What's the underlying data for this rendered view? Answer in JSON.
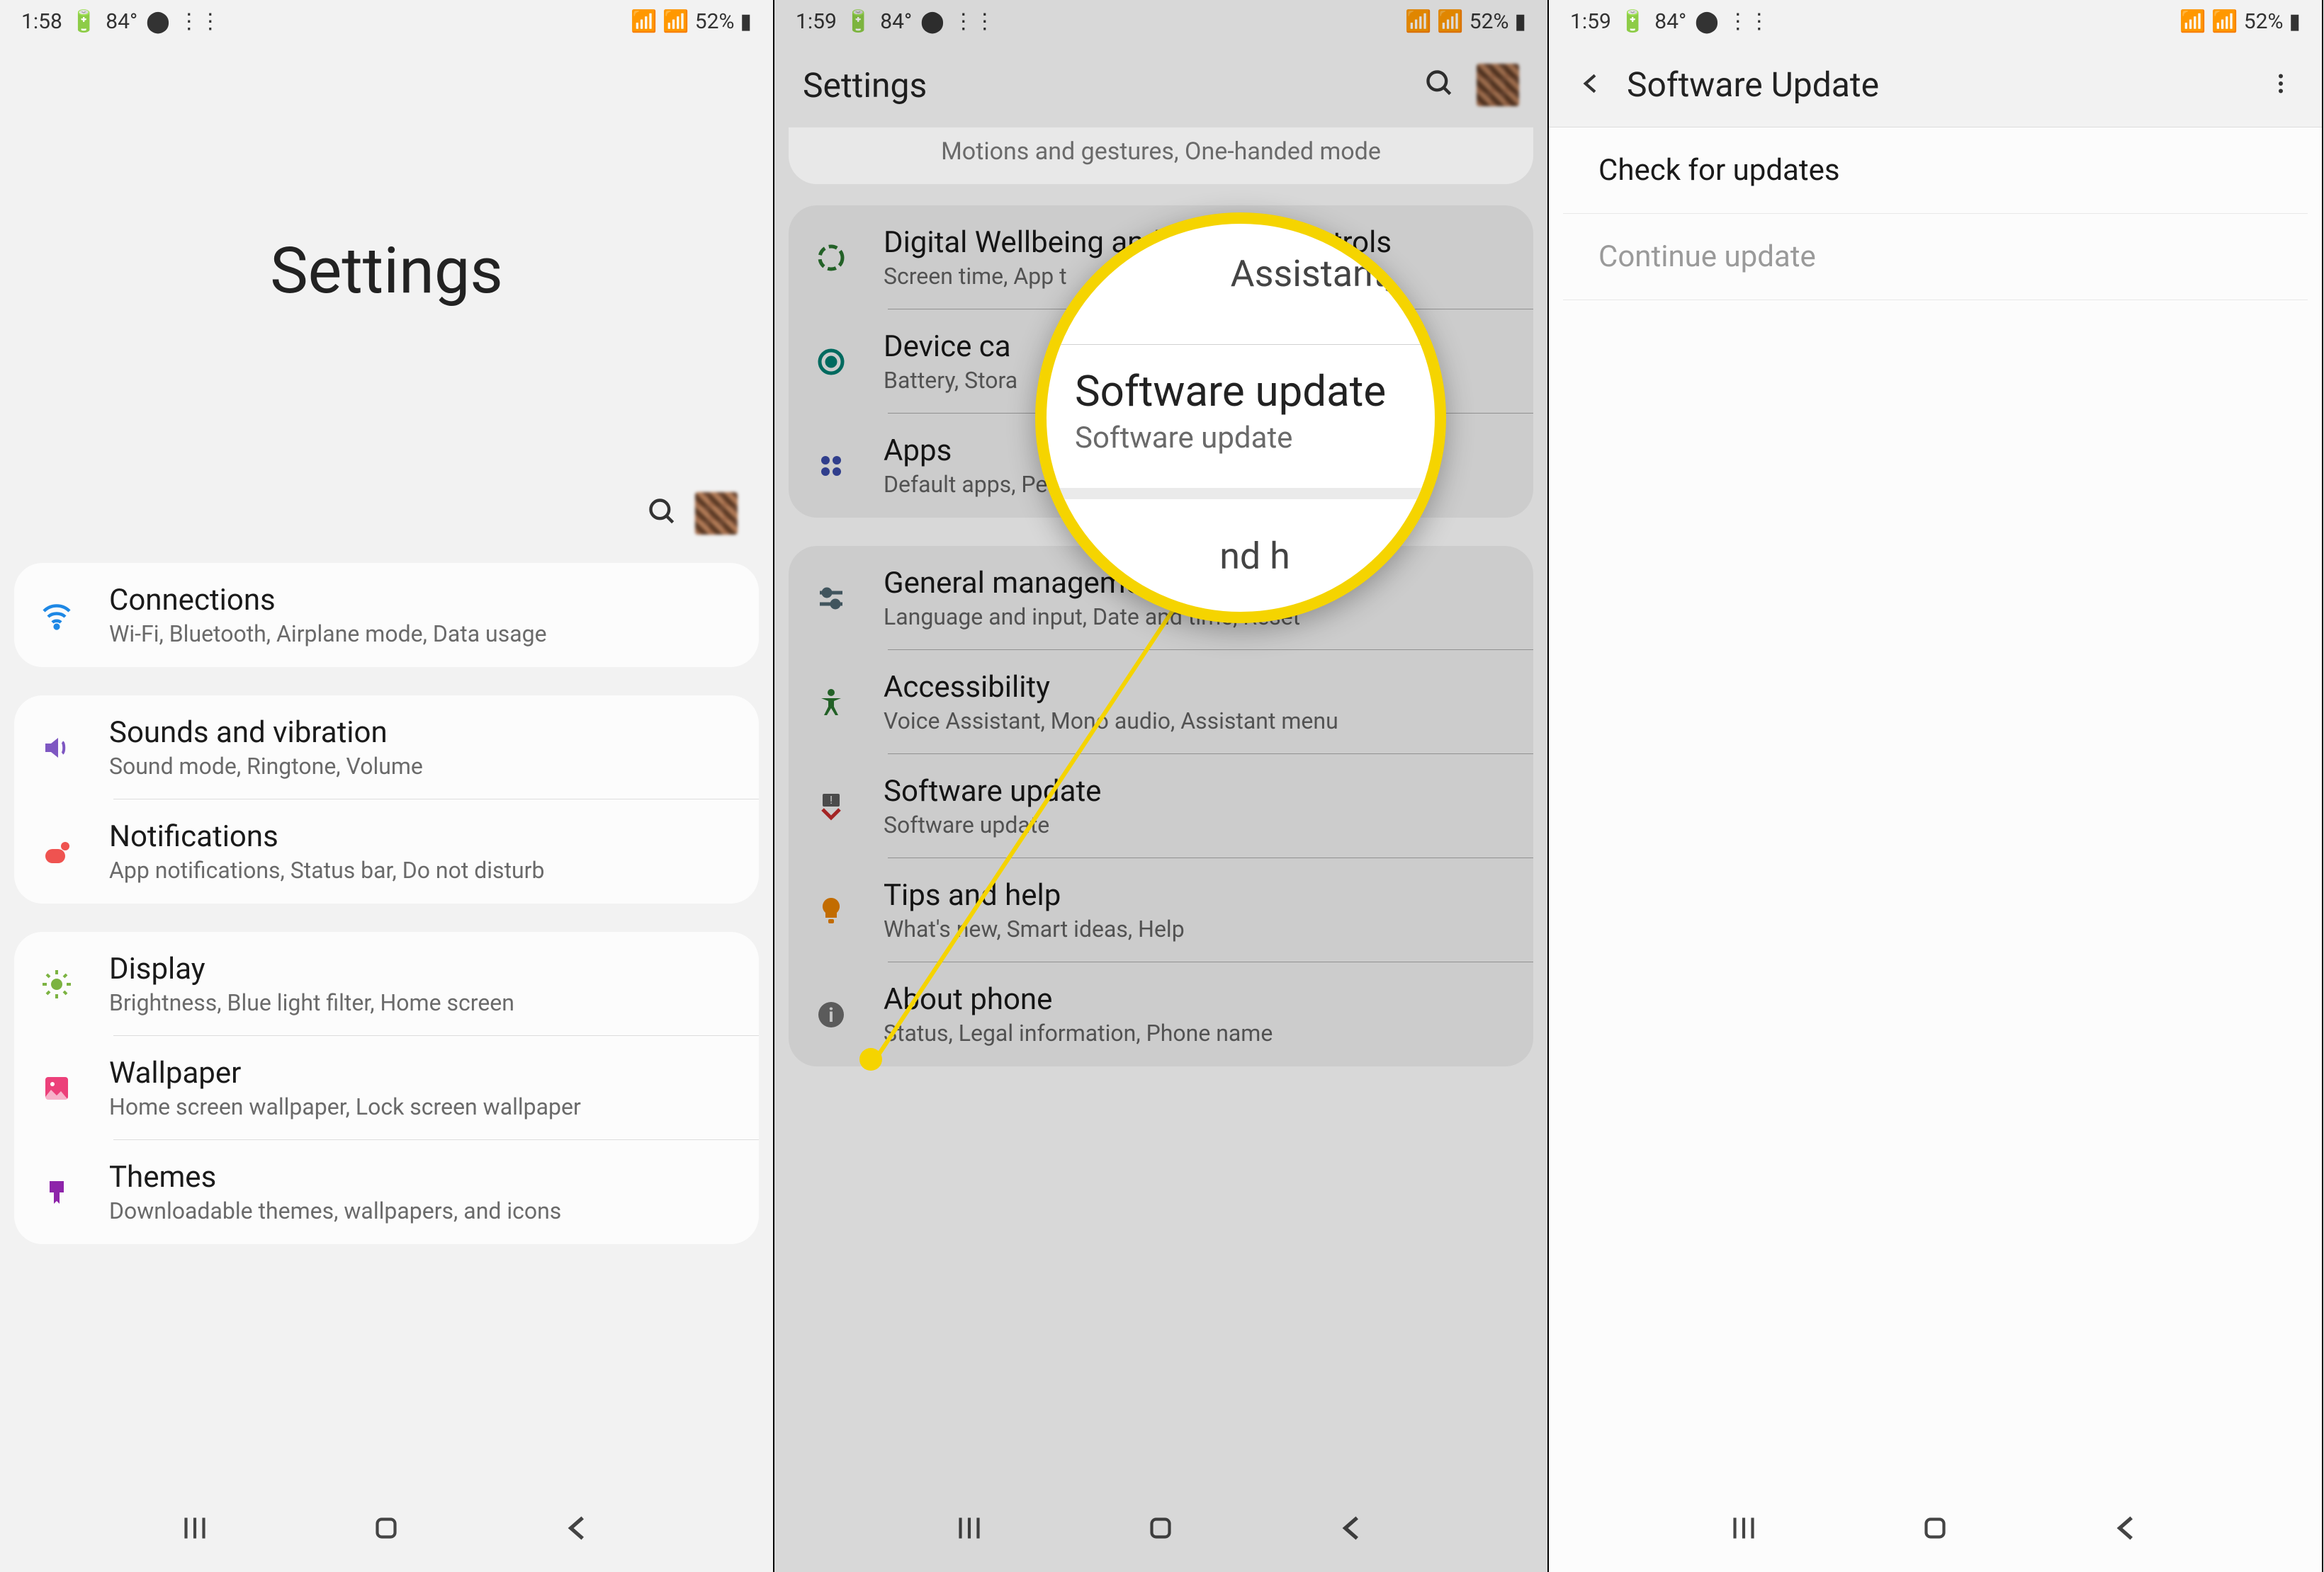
{
  "status": {
    "time1": "1:58",
    "time2": "1:59",
    "time3": "1:59",
    "temp": "84°",
    "battery_pct": "52%"
  },
  "screen1": {
    "title": "Settings",
    "groups": [
      {
        "rows": [
          {
            "icon": "wifi",
            "title": "Connections",
            "sub": "Wi-Fi, Bluetooth, Airplane mode, Data usage"
          }
        ]
      },
      {
        "rows": [
          {
            "icon": "sound",
            "title": "Sounds and vibration",
            "sub": "Sound mode, Ringtone, Volume"
          },
          {
            "icon": "notif",
            "title": "Notifications",
            "sub": "App notifications, Status bar, Do not disturb"
          }
        ]
      },
      {
        "rows": [
          {
            "icon": "display",
            "title": "Display",
            "sub": "Brightness, Blue light filter, Home screen"
          },
          {
            "icon": "wallpaper",
            "title": "Wallpaper",
            "sub": "Home screen wallpaper, Lock screen wallpaper"
          },
          {
            "icon": "themes",
            "title": "Themes",
            "sub": "Downloadable themes, wallpapers, and icons"
          }
        ]
      }
    ]
  },
  "screen2": {
    "title": "Settings",
    "partial_top": "Motions and gestures, One-handed mode",
    "groups": [
      {
        "rows": [
          {
            "icon": "wellbeing",
            "title": "Digital Wellbeing and parental controls",
            "sub": "Screen time, App t"
          },
          {
            "icon": "devicecare",
            "title": "Device ca",
            "sub": "Battery, Stora"
          },
          {
            "icon": "apps",
            "title": "Apps",
            "sub": "Default apps, Pe"
          }
        ]
      },
      {
        "rows": [
          {
            "icon": "general",
            "title": "General management",
            "sub": "Language and input, Date and time, Reset"
          },
          {
            "icon": "accessibility",
            "title": "Accessibility",
            "sub": "Voice Assistant, Mono audio, Assistant menu"
          },
          {
            "icon": "update",
            "title": "Software update",
            "sub": "Software update"
          },
          {
            "icon": "tips",
            "title": "Tips and help",
            "sub": "What's new, Smart ideas, Help"
          },
          {
            "icon": "about",
            "title": "About phone",
            "sub": "Status, Legal information, Phone name"
          }
        ]
      }
    ],
    "magnifier": {
      "frag_top": "Assistant,",
      "title": "Software update",
      "sub": "Software update",
      "frag_bot": "nd h"
    }
  },
  "screen3": {
    "title": "Software Update",
    "items": [
      {
        "label": "Check for updates",
        "enabled": true
      },
      {
        "label": "Continue update",
        "enabled": false
      }
    ]
  }
}
